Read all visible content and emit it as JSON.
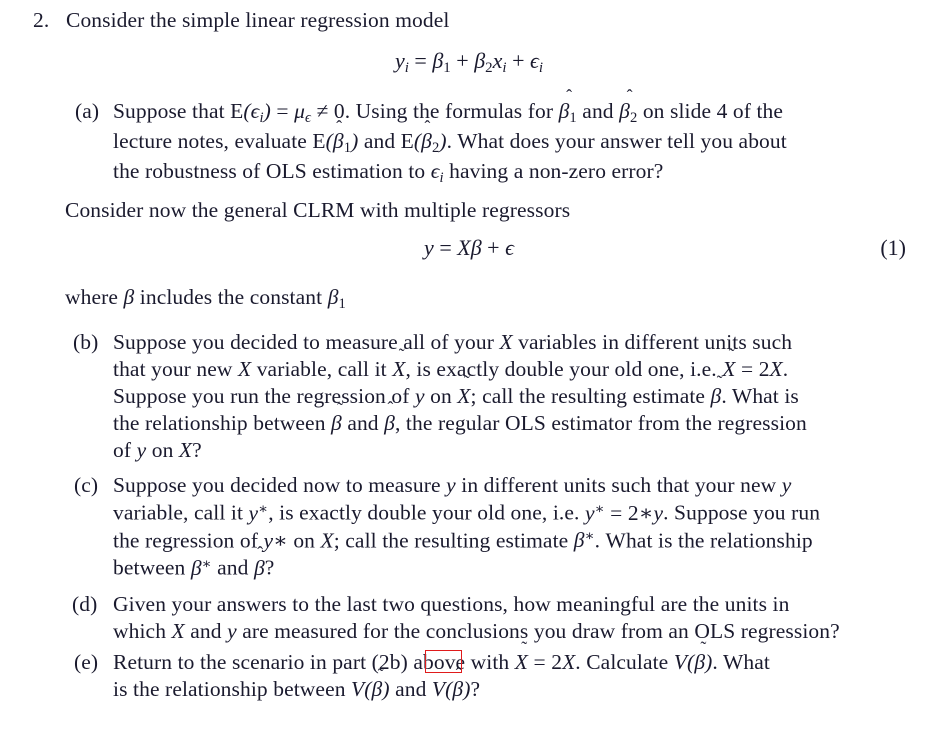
{
  "document": {
    "type": "problem-set-question",
    "background_color": "#ffffff",
    "text_color": "#1a1a2e",
    "annotation_color": "#e01b1b"
  },
  "question": {
    "number": "2.",
    "stem": "Consider the simple linear regression model",
    "display_equation_1": "y_i = β₁ + β₂x_i + ϵ_i"
  },
  "part_a": {
    "label": "(a)",
    "line1_pre": "Suppose that ",
    "line1_math1": "E(ϵ_i) = μ_ϵ ≠ 0",
    "line1_mid": ". Using the formulas for ",
    "line1_math2": "β̂₁",
    "line1_and": " and ",
    "line1_math3": "β̂₂",
    "line1_post": " on slide 4 of the",
    "line2_pre": "lecture notes, evaluate ",
    "line2_math1": "E(β̂₁)",
    "line2_and": " and ",
    "line2_math2": "E(β̂₂)",
    "line2_post": ". What does your answer tell you about",
    "line3_pre": "the robustness of OLS estimation to ",
    "line3_math": "ϵ_i",
    "line3_post": " having a non-zero error?"
  },
  "interlude": {
    "text": "Consider now the general CLRM with multiple regressors",
    "display_equation_2": "y = Xβ + ϵ",
    "equation_number": "(1)",
    "where_pre": "where ",
    "where_beta": "β",
    "where_mid": " includes the constant ",
    "where_beta1": "β₁"
  },
  "part_b": {
    "label": "(b)",
    "line1_pre": "Suppose you decided to measure all of your ",
    "line1_X": "X",
    "line1_post": " variables in different units such",
    "line2_pre": "that your new ",
    "line2_X": "X",
    "line2_mid1": " variable, call it ",
    "line2_Xtilde": "X̃",
    "line2_mid2": ", is exactly double your old one, i.e. ",
    "line2_eq": "X̃ = 2X",
    "line2_post": ".",
    "line3_pre": "Suppose you run the regression of ",
    "line3_y": "y",
    "line3_mid1": " on ",
    "line3_Xtilde": "X̃",
    "line3_mid2": "; call the resulting estimate ",
    "line3_betatilde": "β̃",
    "line3_post": ". What is",
    "line4_pre": "the relationship between ",
    "line4_betatilde": "β̃",
    "line4_and": " and ",
    "line4_betahat": "β̂",
    "line4_post": ", the regular OLS estimator from the regression",
    "line5_pre": "of ",
    "line5_y": "y",
    "line5_mid": " on ",
    "line5_X": "X",
    "line5_post": "?"
  },
  "part_c": {
    "label": "(c)",
    "line1_pre": "Suppose you decided now to measure ",
    "line1_y": "y",
    "line1_mid": " in different units such that your new ",
    "line1_y2": "y",
    "line2_pre": "variable, call it ",
    "line2_ystar": "y*",
    "line2_mid": ", is exactly double your old one, i.e. ",
    "line2_eq": "y* = 2*y",
    "line2_post": ". Suppose you run",
    "line3_pre": "the regression of ",
    "line3_ystar": "y*",
    "line3_mid1": " on ",
    "line3_X": "X",
    "line3_mid2": "; call the resulting estimate ",
    "line3_betastar": "β*",
    "line3_post": ". What is the relationship",
    "line4_pre": "between ",
    "line4_betastar": "β*",
    "line4_and": " and ",
    "line4_betahat": "β̂",
    "line4_post": "?"
  },
  "part_d": {
    "label": "(d)",
    "line1": "Given your answers to the last two questions, how meaningful are the units in",
    "line2_pre": "which ",
    "line2_X": "X",
    "line2_and": " and ",
    "line2_y": "y",
    "line2_post": " are measured for the conclusions you draw from an OLS regression?"
  },
  "part_e": {
    "label": "(e)",
    "line1_pre": "Return to the scenario in part ",
    "line1_ref": "(2b)",
    "line1_mid1": " above with ",
    "line1_eq": "X̃ = 2X",
    "line1_mid2": ". Calculate ",
    "line1_V": "V(β̃)",
    "line1_post": ". What",
    "line2_pre": "is the relationship between ",
    "line2_V1": "V(β̃)",
    "line2_and": " and ",
    "line2_V2": "V(β̂)",
    "line2_post": "?"
  },
  "annotation": {
    "name": "red-box-around-2b",
    "target_text": "(2b)",
    "color": "#e01b1b"
  }
}
